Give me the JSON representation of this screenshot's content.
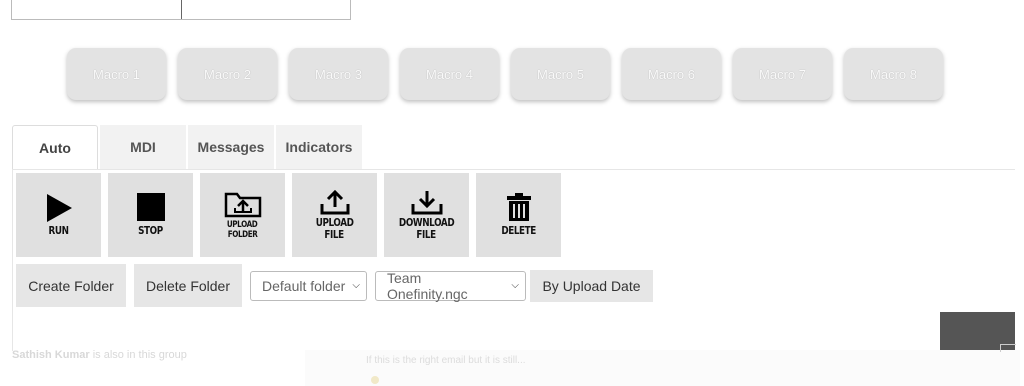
{
  "macros": [
    "Macro 1",
    "Macro 2",
    "Macro 3",
    "Macro 4",
    "Macro 5",
    "Macro 6",
    "Macro 7",
    "Macro 8"
  ],
  "tabs": {
    "auto": "Auto",
    "mdi": "MDI",
    "messages": "Messages",
    "indicators": "Indicators"
  },
  "actions": {
    "run": "RUN",
    "stop": "STOP",
    "upload_folder_1": "UPLOAD",
    "upload_folder_2": "FOLDER",
    "upload_file_1": "UPLOAD",
    "upload_file_2": "FILE",
    "download_file_1": "DOWNLOAD",
    "download_file_2": "FILE",
    "delete": "DELETE"
  },
  "controls": {
    "create_folder": "Create Folder",
    "delete_folder": "Delete Folder",
    "folder_select": "Default folder",
    "file_select": "Team Onefinity.ngc",
    "sort_button": "By Upload Date"
  },
  "footer": {
    "name": "Sathish Kumar",
    "name_suffix": " is also in this group",
    "message": "If this is the right email but it is still..."
  },
  "colors": {
    "button_bg": "#e0e0e0",
    "macro_bg": "#e3e3e3",
    "tab_inactive": "#f2f2f2"
  }
}
